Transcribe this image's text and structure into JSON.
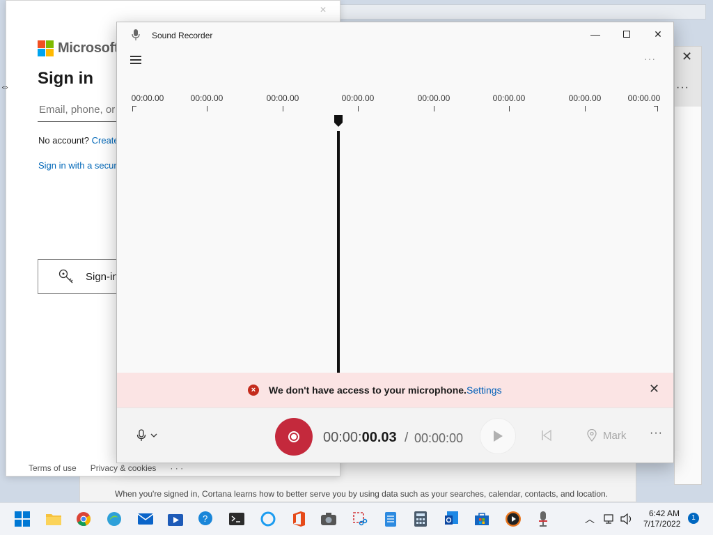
{
  "microsoft": {
    "brand": "Microsoft",
    "title": "Sign in",
    "email_placeholder": "Email, phone, or S",
    "no_account": "No account?",
    "create_link": "Create",
    "security_key_link": "Sign in with a securi",
    "signin_options": "Sign-in",
    "footer": {
      "terms": "Terms of use",
      "privacy": "Privacy & cookies",
      "more": "· · ·"
    }
  },
  "cortana": {
    "notice": "When you're signed in, Cortana learns how to better serve you by using data such as your searches, calendar, contacts, and location."
  },
  "recorder": {
    "title": "Sound Recorder",
    "timeline_labels": [
      "00:00.00",
      "00:00.00",
      "00:00.00",
      "00:00.00",
      "00:00.00",
      "00:00.00",
      "00:00.00",
      "00:00.00"
    ],
    "error_message": "We don't have access to your microphone.",
    "error_settings": "Settings",
    "current_time_prefix": "00:00:",
    "current_time_main": "00.03",
    "time_separator": "/",
    "total_time": "00:00:00",
    "mark_label": "Mark"
  },
  "taskbar": {
    "time": "6:42 AM",
    "date": "7/17/2022",
    "notification_count": "1",
    "icons": [
      "start-icon",
      "file-explorer-icon",
      "chrome-icon",
      "edge-icon",
      "mail-icon",
      "movies-icon",
      "tips-icon",
      "terminal-icon",
      "cortana-icon",
      "office-icon",
      "camera-icon",
      "snipping-tool-icon",
      "notepad-icon",
      "calculator-icon",
      "outlook-icon",
      "store-icon",
      "media-player-icon",
      "sound-recorder-icon"
    ]
  },
  "colors": {
    "record_red": "#c4293c",
    "error_bg": "#fbe4e4",
    "link_blue": "#0067b8",
    "accent": "#0067c0"
  }
}
